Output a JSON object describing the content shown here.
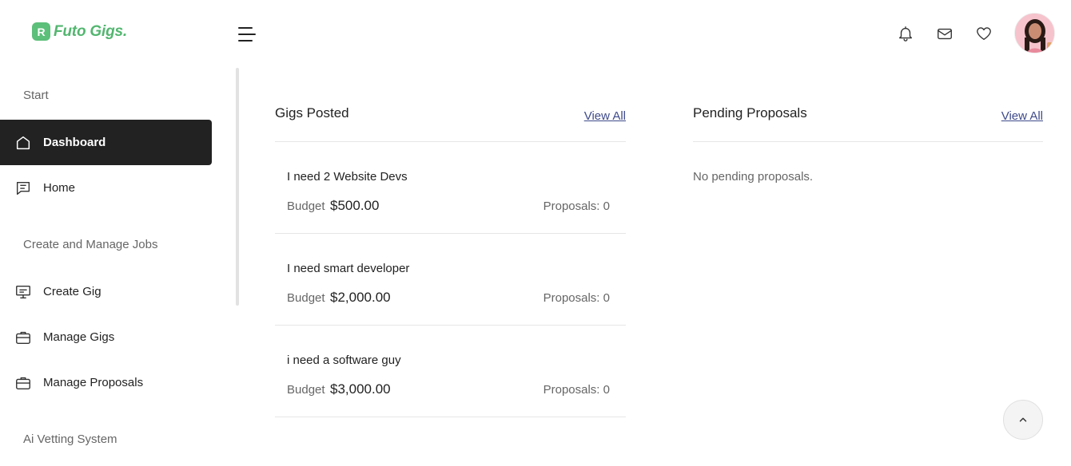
{
  "brand": {
    "logo_letter": "R",
    "name": "Futo Gigs."
  },
  "header": {
    "icons": [
      "bell-icon",
      "mail-icon",
      "heart-icon"
    ]
  },
  "sidebar": {
    "section_start": "Start",
    "dashboard": "Dashboard",
    "home": "Home",
    "section_jobs": "Create and Manage Jobs",
    "create_gig": "Create Gig",
    "manage_gigs": "Manage Gigs",
    "manage_proposals": "Manage Proposals",
    "section_ai": "Ai Vetting System"
  },
  "gigs": {
    "title": "Gigs Posted",
    "view_all": "View All",
    "budget_label": "Budget",
    "items": [
      {
        "title": "I need 2 Website Devs",
        "budget": "$500.00",
        "proposals": "Proposals: 0"
      },
      {
        "title": "I need smart developer",
        "budget": "$2,000.00",
        "proposals": "Proposals: 0"
      },
      {
        "title": "i need a software guy",
        "budget": "$3,000.00",
        "proposals": "Proposals: 0"
      }
    ]
  },
  "proposals": {
    "title": "Pending Proposals",
    "view_all": "View All",
    "empty": "No pending proposals."
  },
  "colors": {
    "brand": "#52b66f",
    "active_nav": "#222222",
    "link": "#3e4a8a"
  }
}
